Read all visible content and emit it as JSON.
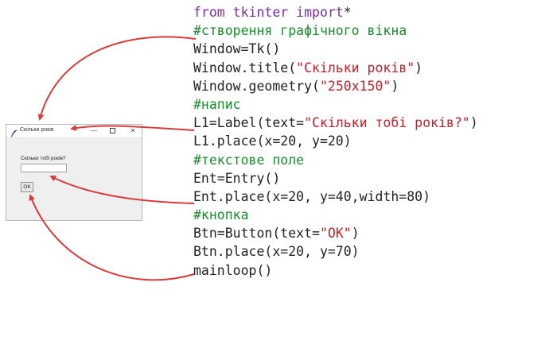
{
  "code_lines": [
    {
      "parts": [
        {
          "t": "from tkinter import",
          "c": "kw"
        },
        {
          "t": "*",
          "c": ""
        }
      ]
    },
    {
      "parts": [
        {
          "t": "#створення графічного вікна",
          "c": "cm"
        }
      ]
    },
    {
      "parts": [
        {
          "t": "Window=Tk()",
          "c": ""
        }
      ]
    },
    {
      "parts": [
        {
          "t": "Window.title(",
          "c": ""
        },
        {
          "t": "\"Скільки років\"",
          "c": "str"
        },
        {
          "t": ")",
          "c": ""
        }
      ]
    },
    {
      "parts": [
        {
          "t": "Window.geometry(",
          "c": ""
        },
        {
          "t": "\"250x150\"",
          "c": "str"
        },
        {
          "t": ")",
          "c": ""
        }
      ]
    },
    {
      "parts": [
        {
          "t": "#напис",
          "c": "cm"
        }
      ]
    },
    {
      "parts": [
        {
          "t": "L1=Label(text=",
          "c": ""
        },
        {
          "t": "\"Скільки тобі років?\"",
          "c": "str"
        },
        {
          "t": ")",
          "c": ""
        }
      ]
    },
    {
      "parts": [
        {
          "t": "L1.place(x=20, y=20)",
          "c": ""
        }
      ]
    },
    {
      "parts": [
        {
          "t": "#текстове поле",
          "c": "cm"
        }
      ]
    },
    {
      "parts": [
        {
          "t": "Ent=Entry()",
          "c": ""
        }
      ]
    },
    {
      "parts": [
        {
          "t": "Ent.place(x=20, y=40,width=80)",
          "c": ""
        }
      ]
    },
    {
      "parts": [
        {
          "t": "#кнопка",
          "c": "cm"
        }
      ]
    },
    {
      "parts": [
        {
          "t": "Btn=Button(text=",
          "c": ""
        },
        {
          "t": "\"OK\"",
          "c": "str"
        },
        {
          "t": ")",
          "c": ""
        }
      ]
    },
    {
      "parts": [
        {
          "t": "Btn.place(x=20, y=70)",
          "c": ""
        }
      ]
    },
    {
      "parts": [
        {
          "t": "mainloop()",
          "c": ""
        }
      ]
    }
  ],
  "tk_window": {
    "title": "Скільки років",
    "minimize": "—",
    "close": "✕",
    "label": "Скільки тобі років?",
    "entry_value": "",
    "button": "OK"
  },
  "colors": {
    "keyword": "#7a2ea0",
    "comment": "#1a8a2e",
    "string": "#c8202a",
    "arrow": "#d93a3a"
  },
  "icons": {
    "window_icon": "tk-feather-icon"
  }
}
